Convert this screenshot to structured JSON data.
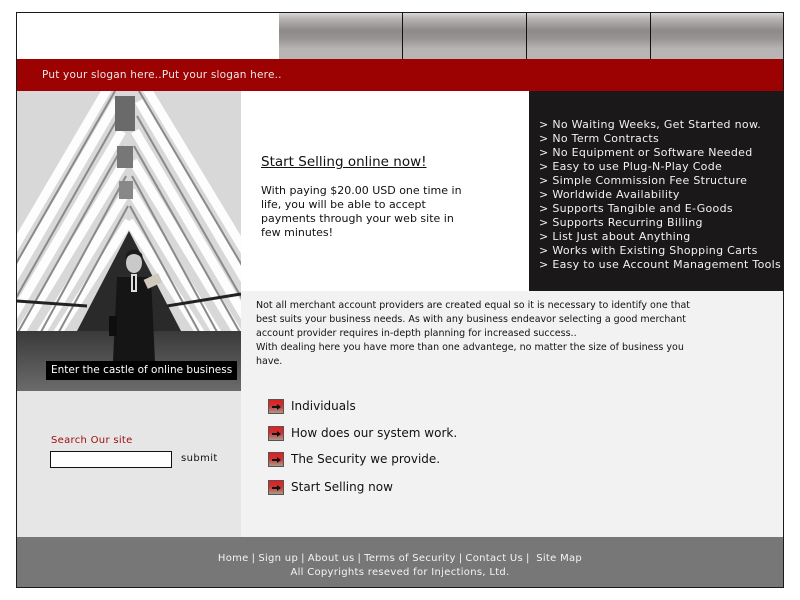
{
  "header": {
    "nav_tabs": [
      "",
      "",
      "",
      ""
    ]
  },
  "slogan": "Put your slogan here..Put your slogan here..",
  "hero": {
    "caption": "Enter the castle of online business"
  },
  "intro": {
    "title": "Start Selling online now!",
    "text": "With paying $20.00 USD one time in life, you will be able to accept payments through your web site in few minutes!"
  },
  "features": [
    "> No Waiting Weeks, Get Started now.",
    "> No Term Contracts",
    "> No Equipment or Software Needed",
    "> Easy to use Plug-N-Play Code",
    "> Simple Commission Fee Structure",
    "> Worldwide Availability",
    "> Supports Tangible and E-Goods",
    "> Supports Recurring Billing",
    "> List Just about Anything",
    "> Works with Existing Shopping Carts",
    "> Easy to use Account Management Tools"
  ],
  "description": {
    "p1": "Not all merchant account providers are created equal so it is necessary to identify one that best suits your business needs. As with any business endeavor selecting a good merchant account provider requires in-depth planning for increased success..",
    "p2": "With dealing here you have more than one advantege, no matter the size of business you have."
  },
  "search": {
    "label": "Search Our site",
    "value": "",
    "placeholder": "",
    "submit_label": "submit"
  },
  "links": [
    {
      "label": "Individuals",
      "icon": "arrow-right-icon"
    },
    {
      "label": "How does our system work.",
      "icon": "arrow-right-icon"
    },
    {
      "label": "The Security we provide.",
      "icon": "arrow-right-icon"
    },
    {
      "label": "Start Selling now",
      "icon": "arrow-right-icon"
    }
  ],
  "footer": {
    "links": [
      "Home",
      "Sign up",
      "About us",
      "Terms of Security",
      "Contact Us",
      "Site Map"
    ],
    "separator": "|",
    "copyright": "All Copyrights reseved for Injections, Ltd."
  },
  "colors": {
    "brand_red": "#9c0202",
    "features_bg": "#1a1818",
    "footer_bg": "#777777",
    "search_label": "#a00e0e"
  }
}
